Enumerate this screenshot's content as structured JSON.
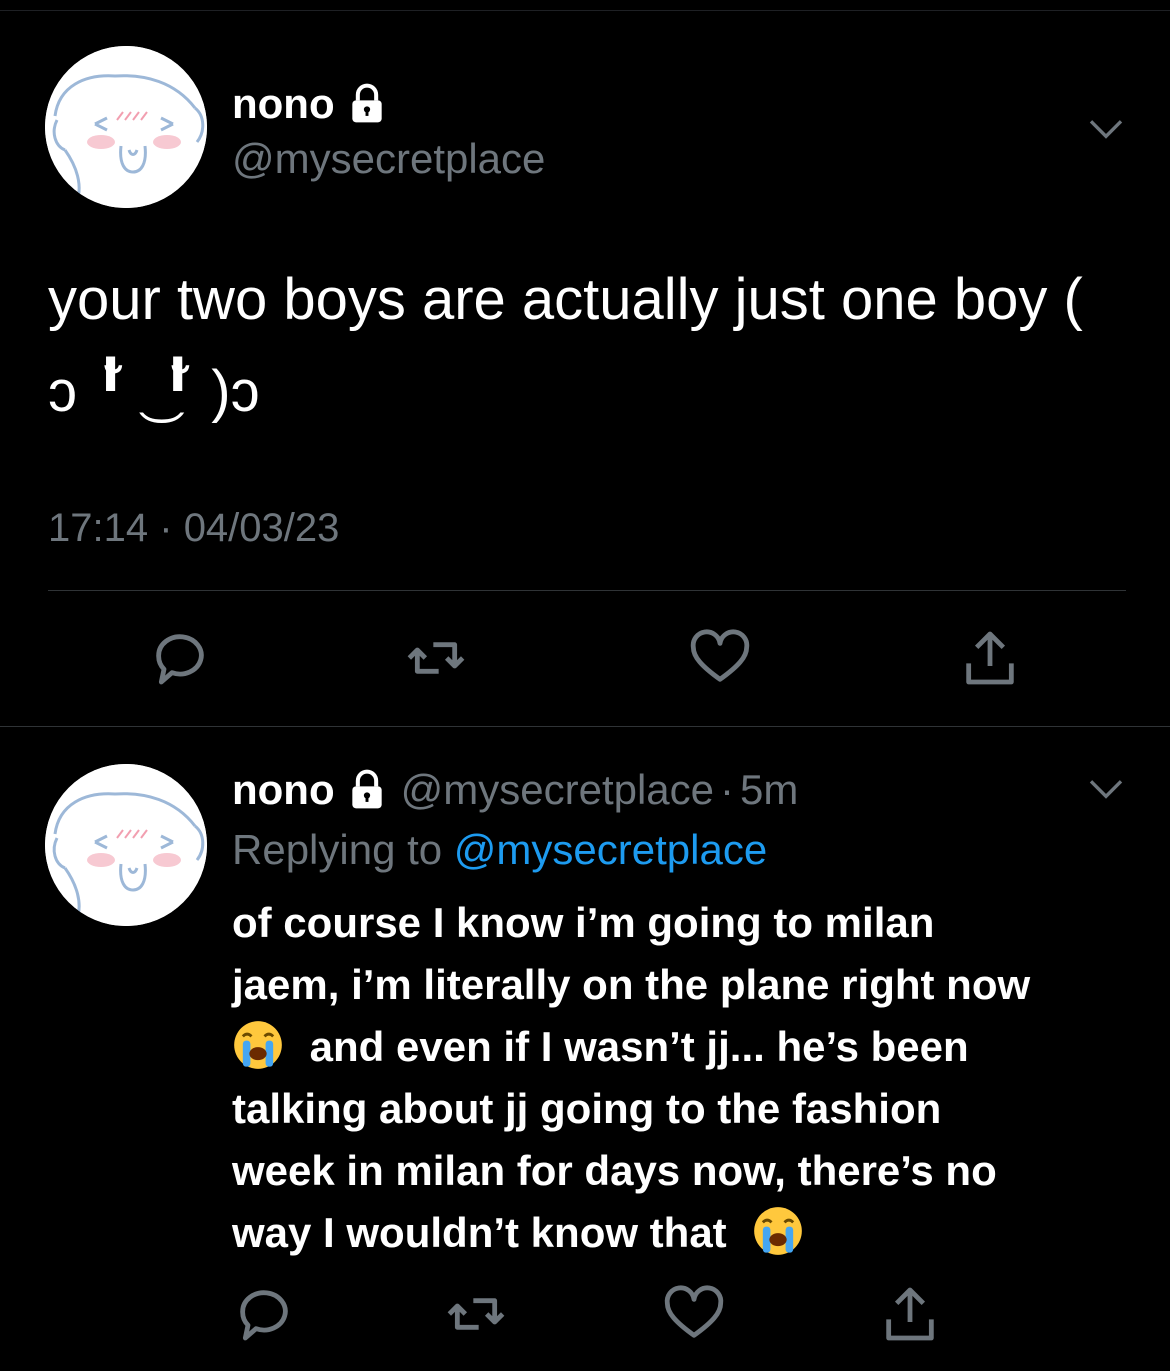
{
  "tweet": {
    "display_name": "nono",
    "handle": "@mysecretplace",
    "text": "your two boys are actually just one boy ( ͻ ╹̆ ͜ ╹̆ )ͻ",
    "time": "17:14",
    "separator": "·",
    "date": "04/03/23"
  },
  "reply": {
    "display_name": "nono",
    "handle": "@mysecretplace",
    "separator": "·",
    "age": "5m",
    "replying_prefix": "Replying to ",
    "replying_to": "@mysecretplace",
    "text_line_1": "of course I know i’m going to milan",
    "text_line_2": "jaem, i’m literally on the plane right now",
    "text_line_3": "and even if I wasn’t jj... he’s been",
    "text_line_4": "talking about jj going to the fashion",
    "text_line_5": "week in milan for days now, there’s no",
    "text_line_6": "way I wouldn’t know that"
  },
  "icons": {
    "lock": "lock-icon",
    "chevron": "chevron-down-icon",
    "reply": "reply-icon",
    "retweet": "retweet-icon",
    "like": "heart-icon",
    "share": "share-icon",
    "crying_emoji": "loudly-crying-face-emoji"
  },
  "colors": {
    "background": "#000000",
    "primary_text": "#ffffff",
    "secondary_text": "#6e767d",
    "link": "#1d9bf0",
    "divider": "#2f3336"
  }
}
